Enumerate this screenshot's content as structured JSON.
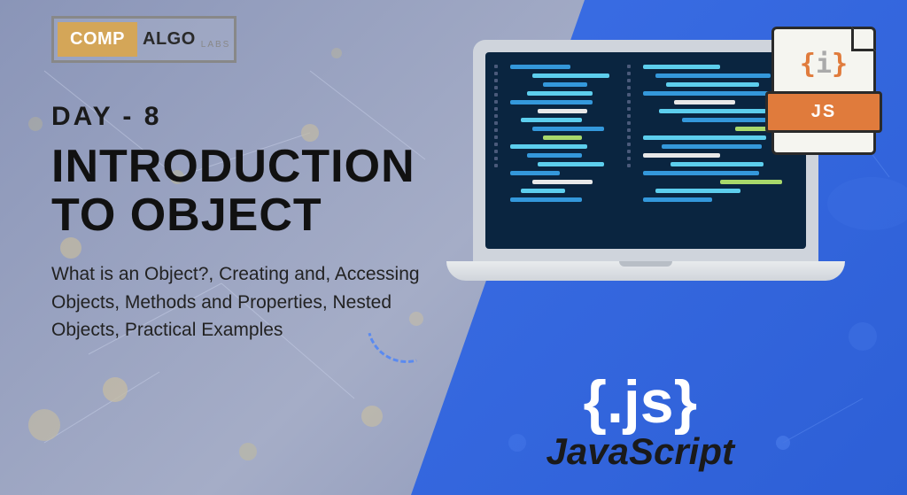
{
  "logo": {
    "comp": "COMP",
    "algo": "ALGO",
    "labs": "LABS"
  },
  "day_label": "DAY - 8",
  "main_title": "INTRODUCTION TO OBJECT",
  "description": "What is an Object?, Creating and, Accessing Objects, Methods and Properties, Nested Objects, Practical Examples",
  "file_icon": {
    "braces_content": "{i}",
    "badge": "JS"
  },
  "js_logo": {
    "braces": "{.js}",
    "text": "JavaScript"
  }
}
